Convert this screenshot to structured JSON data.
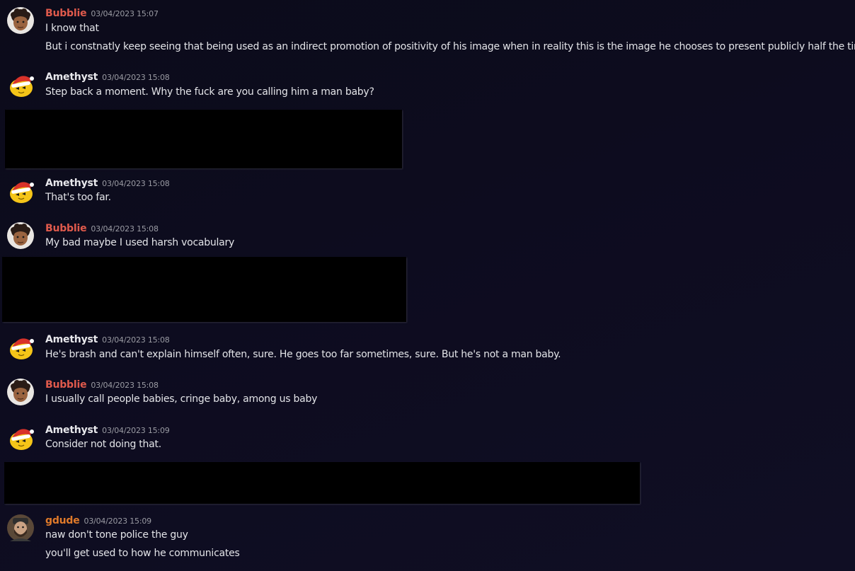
{
  "colors": {
    "bubblie": "#e05a4c",
    "amethyst": "#e8e8ec",
    "gdude": "#e07a2a"
  },
  "messages": [
    {
      "author": "Bubblie",
      "avatar": "bubblie-avatar-icon",
      "timestamp": "03/04/2023 15:07",
      "lines": [
        "I know that",
        "But i constnatly keep seeing that being used as an indirect promotion of positivity of his image when in reality this is the image he chooses to present publicly half the time"
      ]
    },
    {
      "author": "Amethyst",
      "avatar": "amethyst-avatar-icon",
      "timestamp": "03/04/2023 15:08",
      "lines": [
        "Step back a moment. Why the fuck are you calling him a man baby?"
      ]
    },
    {
      "author": "Amethyst",
      "avatar": "amethyst-avatar-icon",
      "timestamp": "03/04/2023 15:08",
      "lines": [
        "That's too far."
      ]
    },
    {
      "author": "Bubblie",
      "avatar": "bubblie-avatar-icon",
      "timestamp": "03/04/2023 15:08",
      "lines": [
        "My bad maybe I used harsh vocabulary"
      ]
    },
    {
      "author": "Amethyst",
      "avatar": "amethyst-avatar-icon",
      "timestamp": "03/04/2023 15:08",
      "lines": [
        "He's brash and can't explain himself often, sure. He goes too far sometimes, sure. But he's not a man baby."
      ]
    },
    {
      "author": "Bubblie",
      "avatar": "bubblie-avatar-icon",
      "timestamp": "03/04/2023 15:08",
      "lines": [
        "I usually call people babies, cringe baby, among us baby"
      ]
    },
    {
      "author": "Amethyst",
      "avatar": "amethyst-avatar-icon",
      "timestamp": "03/04/2023 15:09",
      "lines": [
        "Consider not doing that."
      ]
    },
    {
      "author": "gdude",
      "avatar": "gdude-avatar-icon",
      "timestamp": "03/04/2023 15:09",
      "lines": [
        "naw don't tone police the guy",
        "you'll get used to how he communicates"
      ]
    }
  ]
}
